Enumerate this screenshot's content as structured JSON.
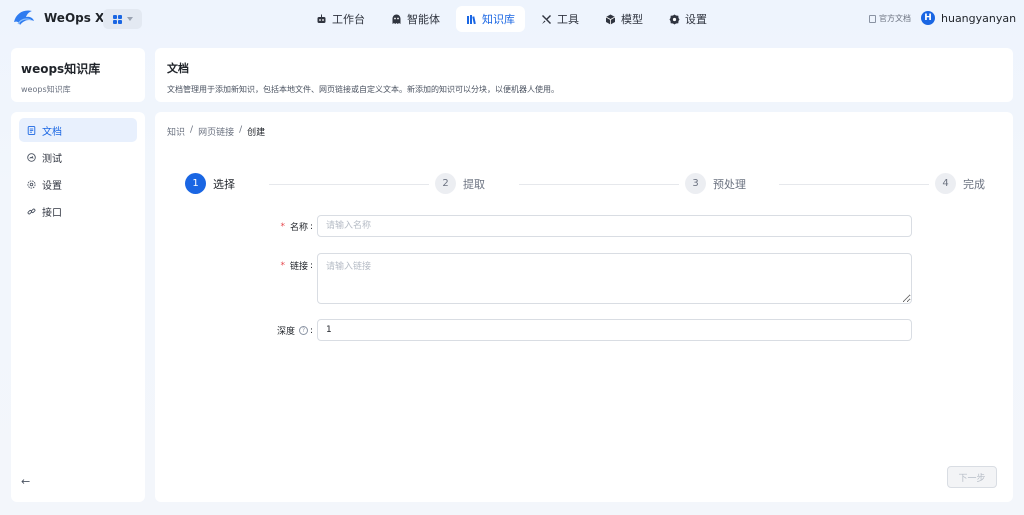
{
  "app": {
    "name": "WeOps X",
    "brand_color": "#1a66e3"
  },
  "nav": [
    {
      "label": "工作台",
      "icon": "robot-icon",
      "active": false
    },
    {
      "label": "智能体",
      "icon": "agent-icon",
      "active": false
    },
    {
      "label": "知识库",
      "icon": "books-icon",
      "active": true
    },
    {
      "label": "工具",
      "icon": "tools-icon",
      "active": false
    },
    {
      "label": "模型",
      "icon": "cube-icon",
      "active": false
    },
    {
      "label": "设置",
      "icon": "gear-icon",
      "active": false
    }
  ],
  "header_right": {
    "doc_link": "官方文档",
    "avatar_letter": "H",
    "user_name": "huangyanyan"
  },
  "knowledge_base": {
    "title": "weops知识库",
    "subtitle": "weops知识库"
  },
  "side_menu": [
    {
      "label": "文档",
      "icon": "document-icon",
      "active": true
    },
    {
      "label": "测试",
      "icon": "test-icon",
      "active": false
    },
    {
      "label": "设置",
      "icon": "settings-icon",
      "active": false
    },
    {
      "label": "接口",
      "icon": "link-icon",
      "active": false
    }
  ],
  "page_header": {
    "title": "文档",
    "description": "文档管理用于添加新知识，包括本地文件、网页链接或自定义文本。新添加的知识可以分块，以便机器人使用。"
  },
  "breadcrumb": {
    "items": [
      "知识",
      "网页链接",
      "创建"
    ],
    "separator": "/"
  },
  "steps": [
    {
      "number": "1",
      "label": "选择",
      "active": true
    },
    {
      "number": "2",
      "label": "提取",
      "active": false
    },
    {
      "number": "3",
      "label": "预处理",
      "active": false
    },
    {
      "number": "4",
      "label": "完成",
      "active": false
    }
  ],
  "form": {
    "name": {
      "label": "名称",
      "required_mark": "*",
      "placeholder": "请输入名称",
      "value": ""
    },
    "link": {
      "label": "链接",
      "required_mark": "*",
      "placeholder": "请输入链接",
      "value": ""
    },
    "depth": {
      "label": "深度",
      "help_mark": "?",
      "value": "1"
    },
    "colon": ":"
  },
  "actions": {
    "next_label": "下一步"
  }
}
